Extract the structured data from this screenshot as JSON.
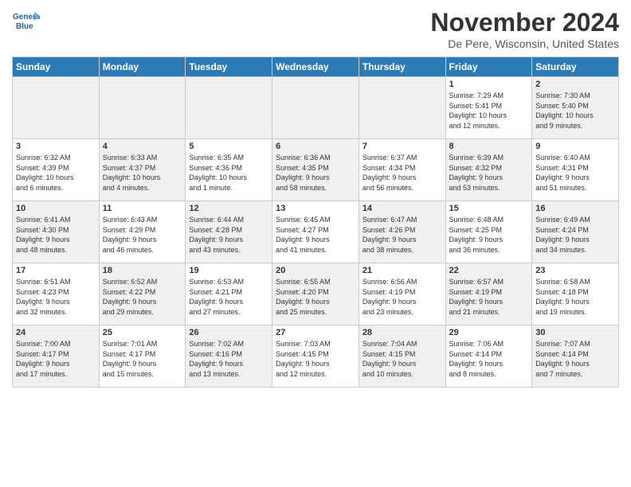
{
  "header": {
    "logo_line1": "General",
    "logo_line2": "Blue",
    "month_title": "November 2024",
    "location": "De Pere, Wisconsin, United States"
  },
  "days_of_week": [
    "Sunday",
    "Monday",
    "Tuesday",
    "Wednesday",
    "Thursday",
    "Friday",
    "Saturday"
  ],
  "weeks": [
    [
      {
        "day": "",
        "info": "",
        "shaded": true
      },
      {
        "day": "",
        "info": "",
        "shaded": true
      },
      {
        "day": "",
        "info": "",
        "shaded": true
      },
      {
        "day": "",
        "info": "",
        "shaded": true
      },
      {
        "day": "",
        "info": "",
        "shaded": true
      },
      {
        "day": "1",
        "info": "Sunrise: 7:29 AM\nSunset: 5:41 PM\nDaylight: 10 hours\nand 12 minutes.",
        "shaded": false
      },
      {
        "day": "2",
        "info": "Sunrise: 7:30 AM\nSunset: 5:40 PM\nDaylight: 10 hours\nand 9 minutes.",
        "shaded": true
      }
    ],
    [
      {
        "day": "3",
        "info": "Sunrise: 6:32 AM\nSunset: 4:39 PM\nDaylight: 10 hours\nand 6 minutes.",
        "shaded": false
      },
      {
        "day": "4",
        "info": "Sunrise: 6:33 AM\nSunset: 4:37 PM\nDaylight: 10 hours\nand 4 minutes.",
        "shaded": true
      },
      {
        "day": "5",
        "info": "Sunrise: 6:35 AM\nSunset: 4:36 PM\nDaylight: 10 hours\nand 1 minute.",
        "shaded": false
      },
      {
        "day": "6",
        "info": "Sunrise: 6:36 AM\nSunset: 4:35 PM\nDaylight: 9 hours\nand 58 minutes.",
        "shaded": true
      },
      {
        "day": "7",
        "info": "Sunrise: 6:37 AM\nSunset: 4:34 PM\nDaylight: 9 hours\nand 56 minutes.",
        "shaded": false
      },
      {
        "day": "8",
        "info": "Sunrise: 6:39 AM\nSunset: 4:32 PM\nDaylight: 9 hours\nand 53 minutes.",
        "shaded": true
      },
      {
        "day": "9",
        "info": "Sunrise: 6:40 AM\nSunset: 4:31 PM\nDaylight: 9 hours\nand 51 minutes.",
        "shaded": false
      }
    ],
    [
      {
        "day": "10",
        "info": "Sunrise: 6:41 AM\nSunset: 4:30 PM\nDaylight: 9 hours\nand 48 minutes.",
        "shaded": true
      },
      {
        "day": "11",
        "info": "Sunrise: 6:43 AM\nSunset: 4:29 PM\nDaylight: 9 hours\nand 46 minutes.",
        "shaded": false
      },
      {
        "day": "12",
        "info": "Sunrise: 6:44 AM\nSunset: 4:28 PM\nDaylight: 9 hours\nand 43 minutes.",
        "shaded": true
      },
      {
        "day": "13",
        "info": "Sunrise: 6:45 AM\nSunset: 4:27 PM\nDaylight: 9 hours\nand 41 minutes.",
        "shaded": false
      },
      {
        "day": "14",
        "info": "Sunrise: 6:47 AM\nSunset: 4:26 PM\nDaylight: 9 hours\nand 38 minutes.",
        "shaded": true
      },
      {
        "day": "15",
        "info": "Sunrise: 6:48 AM\nSunset: 4:25 PM\nDaylight: 9 hours\nand 36 minutes.",
        "shaded": false
      },
      {
        "day": "16",
        "info": "Sunrise: 6:49 AM\nSunset: 4:24 PM\nDaylight: 9 hours\nand 34 minutes.",
        "shaded": true
      }
    ],
    [
      {
        "day": "17",
        "info": "Sunrise: 6:51 AM\nSunset: 4:23 PM\nDaylight: 9 hours\nand 32 minutes.",
        "shaded": false
      },
      {
        "day": "18",
        "info": "Sunrise: 6:52 AM\nSunset: 4:22 PM\nDaylight: 9 hours\nand 29 minutes.",
        "shaded": true
      },
      {
        "day": "19",
        "info": "Sunrise: 6:53 AM\nSunset: 4:21 PM\nDaylight: 9 hours\nand 27 minutes.",
        "shaded": false
      },
      {
        "day": "20",
        "info": "Sunrise: 6:55 AM\nSunset: 4:20 PM\nDaylight: 9 hours\nand 25 minutes.",
        "shaded": true
      },
      {
        "day": "21",
        "info": "Sunrise: 6:56 AM\nSunset: 4:19 PM\nDaylight: 9 hours\nand 23 minutes.",
        "shaded": false
      },
      {
        "day": "22",
        "info": "Sunrise: 6:57 AM\nSunset: 4:19 PM\nDaylight: 9 hours\nand 21 minutes.",
        "shaded": true
      },
      {
        "day": "23",
        "info": "Sunrise: 6:58 AM\nSunset: 4:18 PM\nDaylight: 9 hours\nand 19 minutes.",
        "shaded": false
      }
    ],
    [
      {
        "day": "24",
        "info": "Sunrise: 7:00 AM\nSunset: 4:17 PM\nDaylight: 9 hours\nand 17 minutes.",
        "shaded": true
      },
      {
        "day": "25",
        "info": "Sunrise: 7:01 AM\nSunset: 4:17 PM\nDaylight: 9 hours\nand 15 minutes.",
        "shaded": false
      },
      {
        "day": "26",
        "info": "Sunrise: 7:02 AM\nSunset: 4:16 PM\nDaylight: 9 hours\nand 13 minutes.",
        "shaded": true
      },
      {
        "day": "27",
        "info": "Sunrise: 7:03 AM\nSunset: 4:15 PM\nDaylight: 9 hours\nand 12 minutes.",
        "shaded": false
      },
      {
        "day": "28",
        "info": "Sunrise: 7:04 AM\nSunset: 4:15 PM\nDaylight: 9 hours\nand 10 minutes.",
        "shaded": true
      },
      {
        "day": "29",
        "info": "Sunrise: 7:06 AM\nSunset: 4:14 PM\nDaylight: 9 hours\nand 8 minutes.",
        "shaded": false
      },
      {
        "day": "30",
        "info": "Sunrise: 7:07 AM\nSunset: 4:14 PM\nDaylight: 9 hours\nand 7 minutes.",
        "shaded": true
      }
    ]
  ]
}
